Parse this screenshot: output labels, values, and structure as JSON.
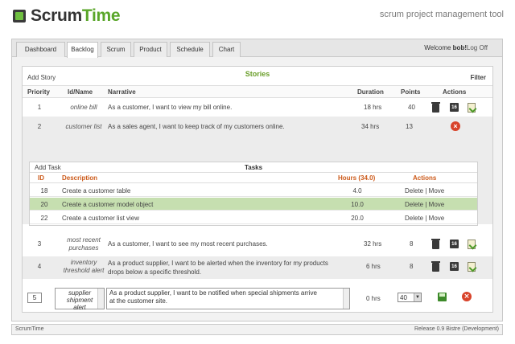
{
  "app": {
    "logo_part1": "Scrum",
    "logo_part2": "Time",
    "tagline": "scrum project management tool"
  },
  "nav": {
    "tabs": [
      "Dashboard",
      "Backlog",
      "Scrum",
      "Product",
      "Schedule",
      "Chart"
    ],
    "active_tab": "Backlog",
    "welcome_prefix": "Welcome ",
    "username": "bob!",
    "logout": "Log Off"
  },
  "backlog": {
    "add_story": "Add Story",
    "title": "Stories",
    "filter": "Filter",
    "columns": {
      "priority": "Priority",
      "id_name": "Id/Name",
      "narrative": "Narrative",
      "duration": "Duration",
      "points": "Points",
      "actions": "Actions"
    },
    "stories": [
      {
        "priority": "1",
        "id_line1": "online bill",
        "id_line2": "",
        "narrative_line1": "As a customer, I want to view my bill online.",
        "narrative_line2": "",
        "duration": "18 hrs",
        "points": "40"
      },
      {
        "priority": "2",
        "id_line1": "customer list",
        "id_line2": "",
        "narrative_line1": "As a sales agent, I want to keep track of my customers online.",
        "narrative_line2": "",
        "duration": "34 hrs",
        "points": "13"
      },
      {
        "priority": "3",
        "id_line1": "most recent",
        "id_line2": "purchases",
        "narrative_line1": "As a customer, I want to see my most recent purchases.",
        "narrative_line2": "",
        "duration": "32 hrs",
        "points": "8"
      },
      {
        "priority": "4",
        "id_line1": "inventory",
        "id_line2": "threshold alert",
        "narrative_line1": "As a product supplier, I want to be alerted when the inventory for my products",
        "narrative_line2": "drops below a specific threshold.",
        "duration": "6 hrs",
        "points": "8"
      }
    ],
    "icons": {
      "delete": "trash-icon",
      "schedule": "calendar-icon",
      "edit": "edit-icon",
      "close": "cancel-icon",
      "save": "save-icon"
    },
    "calendar_glyph": "16",
    "close_glyph": "×"
  },
  "tasks": {
    "add_task": "Add Task",
    "title": "Tasks",
    "columns": {
      "id": "ID",
      "description": "Description",
      "hours": "Hours (34.0)",
      "actions": "Actions"
    },
    "rows": [
      {
        "id": "18",
        "description": "Create a customer table",
        "hours": "4.0"
      },
      {
        "id": "20",
        "description": "Create a customer model object",
        "hours": "10.0"
      },
      {
        "id": "22",
        "description": "Create a customer list view",
        "hours": "20.0"
      }
    ],
    "delete_label": "Delete",
    "separator": "|",
    "move_label": "Move"
  },
  "edit_story": {
    "priority": "5",
    "id_name_line1": "supplier",
    "id_name_line2": "shipment",
    "id_name_line3": "alert",
    "narrative_line1": "As a product supplier, I want to be notified when special shipments arrive",
    "narrative_line2": "at the customer site.",
    "duration": "0 hrs",
    "points_value": "40",
    "select_arrow": "▼"
  },
  "footer": {
    "left": "ScrumTime",
    "right": "Release 0.9 Bistre (Development)"
  }
}
